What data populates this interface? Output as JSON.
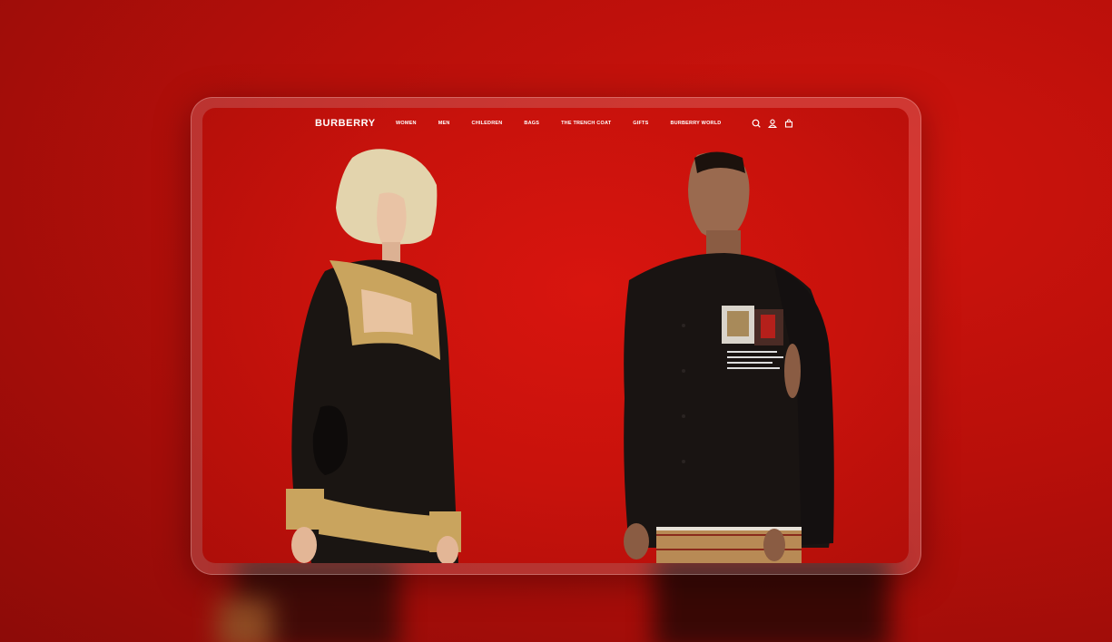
{
  "brand": {
    "logo_text": "BURBERRY"
  },
  "nav": {
    "items": [
      {
        "label": "WOMEN"
      },
      {
        "label": "MEN"
      },
      {
        "label": "CHILEDREN"
      },
      {
        "label": "BAGS"
      },
      {
        "label": "THE TRENCH COAT"
      },
      {
        "label": "GIFTS"
      },
      {
        "label": "BURBERRY WORLD"
      }
    ],
    "icons": [
      "search-icon",
      "user-icon",
      "bag-icon"
    ]
  },
  "colors": {
    "background_red": "#c8120c",
    "frame_glass": "#ffffff",
    "nav_text": "#ffffff"
  }
}
